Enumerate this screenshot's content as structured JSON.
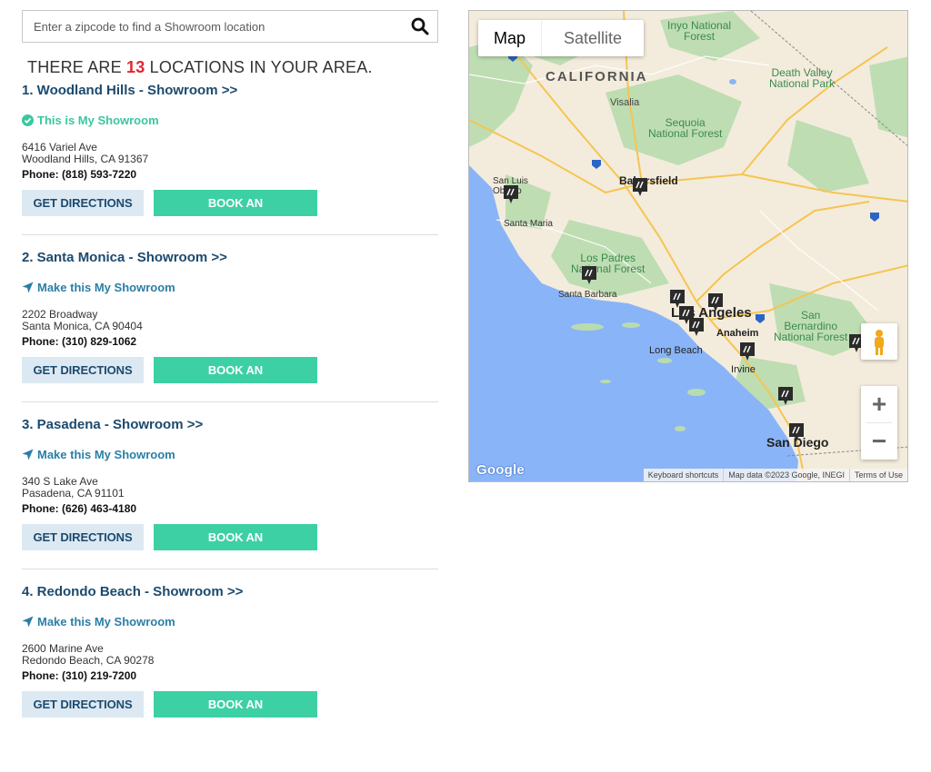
{
  "search": {
    "placeholder": "Enter a zipcode to find a Showroom location",
    "icon": "search-icon"
  },
  "results": {
    "prefix": "THERE ARE",
    "count": "13",
    "suffix": "LOCATIONS IN YOUR AREA."
  },
  "locations": [
    {
      "title": "1. Woodland Hills - Showroom >>",
      "showroom_status": "This is My Showroom",
      "status_icon": "check-circle-icon",
      "address_line1": "6416 Variel Ave",
      "address_line2": "Woodland Hills, CA 91367",
      "phone": "Phone: (818) 593-7220",
      "directions_label": "GET DIRECTIONS",
      "book_label": "BOOK AN APPOINTMENT"
    },
    {
      "title": "2. Santa Monica - Showroom >>",
      "showroom_status": "Make this My Showroom",
      "status_icon": "location-arrow-icon",
      "address_line1": "2202 Broadway",
      "address_line2": "Santa Monica, CA 90404",
      "phone": "Phone: (310) 829-1062",
      "directions_label": "GET DIRECTIONS",
      "book_label": "BOOK AN APPOINTMENT"
    },
    {
      "title": "3. Pasadena - Showroom >>",
      "showroom_status": "Make this My Showroom",
      "status_icon": "location-arrow-icon",
      "address_line1": "340 S Lake Ave",
      "address_line2": "Pasadena, CA 91101",
      "phone": "Phone: (626) 463-4180",
      "directions_label": "GET DIRECTIONS",
      "book_label": "BOOK AN APPOINTMENT"
    },
    {
      "title": "4. Redondo Beach - Showroom >>",
      "showroom_status": "Make this My Showroom",
      "status_icon": "location-arrow-icon",
      "address_line1": "2600 Marine Ave",
      "address_line2": "Redondo Beach, CA 90278",
      "phone": "Phone: (310) 219-7200",
      "directions_label": "GET DIRECTIONS",
      "book_label": "BOOK AN APPOINTMENT"
    }
  ],
  "map": {
    "type_map": "Map",
    "type_satellite": "Satellite",
    "labels": {
      "california": "CALIFORNIA",
      "inyo": "Inyo National\nForest",
      "death_valley": "Death Valley\nNational Park",
      "visalia": "Visalia",
      "sequoia": "Sequoia\nNational Forest",
      "bakersfield": "Bakersfield",
      "san_luis": "San Luis\nObispo",
      "santa_maria": "Santa Maria",
      "los_padres": "Los Padres\nNational Forest",
      "santa_barbara": "Santa Barbara",
      "los_angeles": "Los Angeles",
      "san_bernardino": "San\nBernardino\nNational Forest",
      "anaheim": "Anaheim",
      "long_beach": "Long Beach",
      "irvine": "Irvine",
      "san_diego": "San Diego"
    },
    "logo": "Google",
    "footer_keyboard": "Keyboard shortcuts",
    "footer_data": "Map data ©2023 Google, INEGI",
    "footer_terms": "Terms of Use",
    "zoom_in": "+",
    "zoom_out": "−",
    "colors": {
      "water": "#8ab4f8",
      "land": "#f3ecdc",
      "forest": "#b9dcae",
      "road": "#f6c452",
      "primary_text": "#1c4a6e",
      "accent_green": "#3ed0a5",
      "count_red": "#e0262f"
    }
  }
}
